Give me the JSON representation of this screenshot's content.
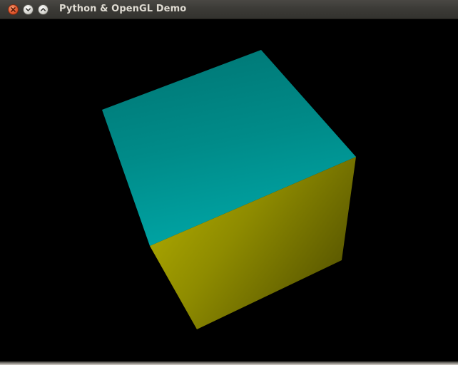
{
  "window": {
    "title": "Python & OpenGL Demo",
    "buttons": [
      {
        "name": "close",
        "icon": "close-icon",
        "color": "#e2592f"
      },
      {
        "name": "minimize",
        "icon": "minimize-icon",
        "color": "#d9d8d3"
      },
      {
        "name": "maximize",
        "icon": "maximize-icon",
        "color": "#d9d8d3"
      }
    ]
  },
  "scene": {
    "background_color": "#000000",
    "object": "cube",
    "faces": {
      "top_color": "#00a0a0",
      "front_color": "#a8a800"
    }
  }
}
